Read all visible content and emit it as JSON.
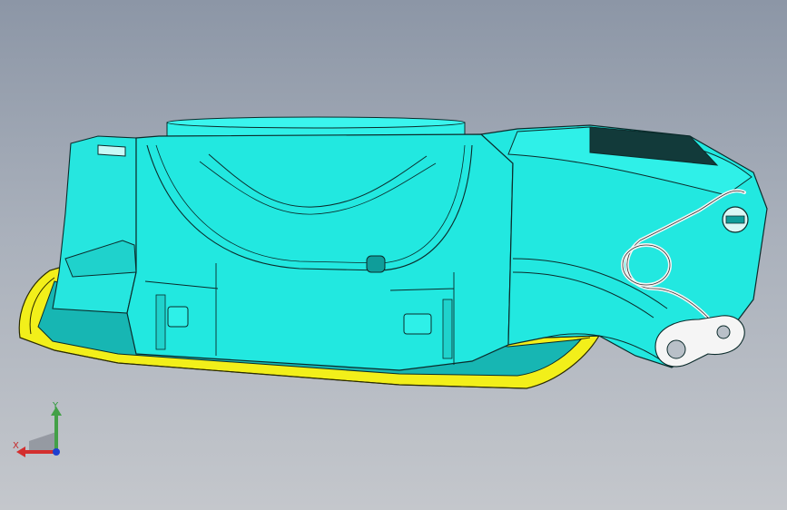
{
  "viewport": {
    "model": "cad-part-shaded"
  },
  "triad": {
    "x_label": "X",
    "y_label": "Y",
    "colors": {
      "x": "#d32f2f",
      "y": "#43a047",
      "z": "#1e3fd0"
    }
  },
  "colors": {
    "background_top": "#8c96a6",
    "background_bottom": "#c4c7cc",
    "part_body": "#22e8e0",
    "part_shade": "#16b9b6",
    "flange": "#f2ef1a",
    "edges": "#0b2b2b"
  }
}
